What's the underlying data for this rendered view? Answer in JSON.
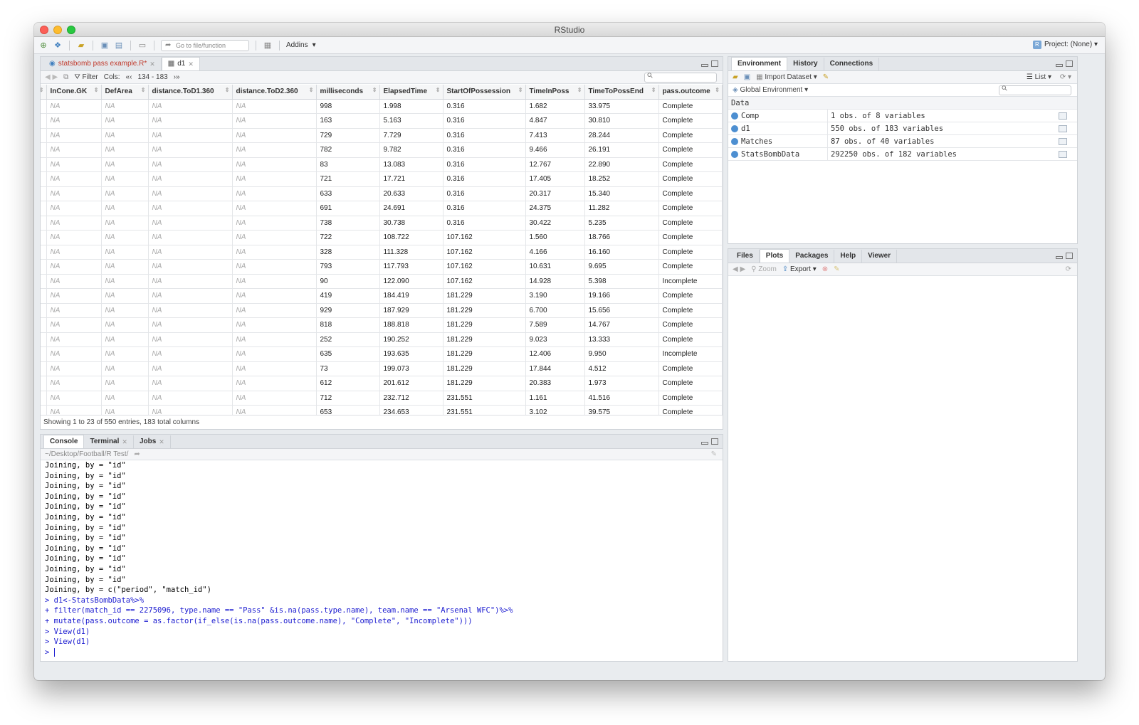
{
  "window": {
    "title": "RStudio"
  },
  "toolbar": {
    "goto_placeholder": "Go to file/function",
    "addins_label": "Addins",
    "project_label": "Project: (None)"
  },
  "source": {
    "tabs": [
      {
        "label": "statsbomb pass example.R*",
        "color": "#c0392b"
      },
      {
        "label": "d1"
      }
    ],
    "filter_label": "Filter",
    "cols_label": "Cols:",
    "cols_range": "134 - 183",
    "columns": [
      "InCone.GK",
      "DefArea",
      "distance.ToD1.360",
      "distance.ToD2.360",
      "milliseconds",
      "ElapsedTime",
      "StartOfPossession",
      "TimeInPoss",
      "TimeToPossEnd",
      "pass.outcome"
    ],
    "rows": [
      [
        "NA",
        "NA",
        "NA",
        "NA",
        "998",
        "1.998",
        "0.316",
        "1.682",
        "33.975",
        "Complete"
      ],
      [
        "NA",
        "NA",
        "NA",
        "NA",
        "163",
        "5.163",
        "0.316",
        "4.847",
        "30.810",
        "Complete"
      ],
      [
        "NA",
        "NA",
        "NA",
        "NA",
        "729",
        "7.729",
        "0.316",
        "7.413",
        "28.244",
        "Complete"
      ],
      [
        "NA",
        "NA",
        "NA",
        "NA",
        "782",
        "9.782",
        "0.316",
        "9.466",
        "26.191",
        "Complete"
      ],
      [
        "NA",
        "NA",
        "NA",
        "NA",
        "83",
        "13.083",
        "0.316",
        "12.767",
        "22.890",
        "Complete"
      ],
      [
        "NA",
        "NA",
        "NA",
        "NA",
        "721",
        "17.721",
        "0.316",
        "17.405",
        "18.252",
        "Complete"
      ],
      [
        "NA",
        "NA",
        "NA",
        "NA",
        "633",
        "20.633",
        "0.316",
        "20.317",
        "15.340",
        "Complete"
      ],
      [
        "NA",
        "NA",
        "NA",
        "NA",
        "691",
        "24.691",
        "0.316",
        "24.375",
        "11.282",
        "Complete"
      ],
      [
        "NA",
        "NA",
        "NA",
        "NA",
        "738",
        "30.738",
        "0.316",
        "30.422",
        "5.235",
        "Complete"
      ],
      [
        "NA",
        "NA",
        "NA",
        "NA",
        "722",
        "108.722",
        "107.162",
        "1.560",
        "18.766",
        "Complete"
      ],
      [
        "NA",
        "NA",
        "NA",
        "NA",
        "328",
        "111.328",
        "107.162",
        "4.166",
        "16.160",
        "Complete"
      ],
      [
        "NA",
        "NA",
        "NA",
        "NA",
        "793",
        "117.793",
        "107.162",
        "10.631",
        "9.695",
        "Complete"
      ],
      [
        "NA",
        "NA",
        "NA",
        "NA",
        "90",
        "122.090",
        "107.162",
        "14.928",
        "5.398",
        "Incomplete"
      ],
      [
        "NA",
        "NA",
        "NA",
        "NA",
        "419",
        "184.419",
        "181.229",
        "3.190",
        "19.166",
        "Complete"
      ],
      [
        "NA",
        "NA",
        "NA",
        "NA",
        "929",
        "187.929",
        "181.229",
        "6.700",
        "15.656",
        "Complete"
      ],
      [
        "NA",
        "NA",
        "NA",
        "NA",
        "818",
        "188.818",
        "181.229",
        "7.589",
        "14.767",
        "Complete"
      ],
      [
        "NA",
        "NA",
        "NA",
        "NA",
        "252",
        "190.252",
        "181.229",
        "9.023",
        "13.333",
        "Complete"
      ],
      [
        "NA",
        "NA",
        "NA",
        "NA",
        "635",
        "193.635",
        "181.229",
        "12.406",
        "9.950",
        "Incomplete"
      ],
      [
        "NA",
        "NA",
        "NA",
        "NA",
        "73",
        "199.073",
        "181.229",
        "17.844",
        "4.512",
        "Complete"
      ],
      [
        "NA",
        "NA",
        "NA",
        "NA",
        "612",
        "201.612",
        "181.229",
        "20.383",
        "1.973",
        "Complete"
      ],
      [
        "NA",
        "NA",
        "NA",
        "NA",
        "712",
        "232.712",
        "231.551",
        "1.161",
        "41.516",
        "Complete"
      ],
      [
        "NA",
        "NA",
        "NA",
        "NA",
        "653",
        "234.653",
        "231.551",
        "3.102",
        "39.575",
        "Complete"
      ]
    ],
    "status": "Showing 1 to 23 of 550 entries, 183 total columns"
  },
  "console": {
    "tabs": [
      "Console",
      "Terminal",
      "Jobs"
    ],
    "path": "~/Desktop/Football/R Test/",
    "output_lines": [
      "Joining, by = \"id\"",
      "Joining, by = \"id\"",
      "Joining, by = \"id\"",
      "Joining, by = \"id\"",
      "Joining, by = \"id\"",
      "Joining, by = \"id\"",
      "Joining, by = \"id\"",
      "Joining, by = \"id\"",
      "Joining, by = \"id\"",
      "Joining, by = \"id\"",
      "Joining, by = \"id\"",
      "Joining, by = \"id\"",
      "Joining, by = c(\"period\", \"match_id\")"
    ],
    "command_lines": [
      "> d1<-StatsBombData%>%",
      "+   filter(match_id == 2275096, type.name == \"Pass\" &is.na(pass.type.name), team.name == \"Arsenal WFC\")%>%",
      "+   mutate(pass.outcome = as.factor(if_else(is.na(pass.outcome.name), \"Complete\", \"Incomplete\")))",
      "> View(d1)",
      "> View(d1)"
    ],
    "prompt": ">"
  },
  "environment": {
    "tabs": [
      "Environment",
      "History",
      "Connections"
    ],
    "import_label": "Import Dataset",
    "list_label": "List",
    "scope_label": "Global Environment",
    "section_label": "Data",
    "items": [
      {
        "name": "Comp",
        "value": "1 obs. of 8 variables"
      },
      {
        "name": "d1",
        "value": "550 obs. of 183 variables"
      },
      {
        "name": "Matches",
        "value": "87 obs. of 40 variables"
      },
      {
        "name": "StatsBombData",
        "value": "292250 obs. of 182 variables"
      }
    ]
  },
  "files": {
    "tabs": [
      "Files",
      "Plots",
      "Packages",
      "Help",
      "Viewer"
    ],
    "zoom_label": "Zoom",
    "export_label": "Export"
  }
}
